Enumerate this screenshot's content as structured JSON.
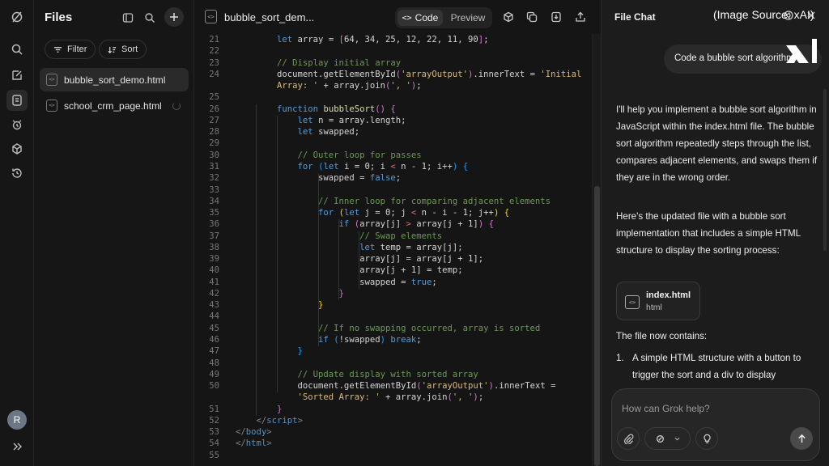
{
  "rail": {
    "avatar_initial": "R"
  },
  "files_panel": {
    "title": "Files",
    "filter_label": "Filter",
    "sort_label": "Sort",
    "files": [
      {
        "name": "bubble_sort_demo.html",
        "active": true
      },
      {
        "name": "school_crm_page.html",
        "active": false
      }
    ]
  },
  "editor": {
    "tab_title": "bubble_sort_dem...",
    "file_icon_glyph": "<>",
    "code_toggle_label": "Code",
    "preview_toggle_label": "Preview",
    "first_line_number": 21,
    "lines": [
      [
        {
          "t": "        let ",
          "c": "kw"
        },
        {
          "t": "array = "
        },
        {
          "t": "[",
          "c": "br2"
        },
        {
          "t": "64, 34, 25, 12, 22, 11, 90"
        },
        {
          "t": "]",
          "c": "br2"
        },
        {
          "t": ";"
        }
      ],
      [],
      [
        {
          "t": "        // Display initial array",
          "c": "com"
        }
      ],
      [
        {
          "t": "        document.getElementById"
        },
        {
          "t": "(",
          "c": "br2"
        },
        {
          "t": "'arrayOutput'",
          "c": "str"
        },
        {
          "t": ")",
          "c": "br2"
        },
        {
          "t": ".innerText = "
        },
        {
          "t": "'Initial",
          "c": "str"
        }
      ],
      [
        {
          "t": "        Array: '",
          "c": "str"
        },
        {
          "t": " + array.join"
        },
        {
          "t": "(",
          "c": "br2"
        },
        {
          "t": "', '",
          "c": "str"
        },
        {
          "t": ")",
          "c": "br2"
        },
        {
          "t": ";"
        }
      ],
      [],
      [
        {
          "t": "        function ",
          "c": "kw"
        },
        {
          "t": "bubbleSort",
          "c": "fn"
        },
        {
          "t": "()",
          "c": "br2"
        },
        {
          "t": " "
        },
        {
          "t": "{",
          "c": "br2"
        }
      ],
      [
        {
          "t": "            let ",
          "c": "kw"
        },
        {
          "t": "n = array.length;"
        }
      ],
      [
        {
          "t": "            let ",
          "c": "kw"
        },
        {
          "t": "swapped;"
        }
      ],
      [],
      [
        {
          "t": "            // Outer loop for passes",
          "c": "com"
        }
      ],
      [
        {
          "t": "            for ",
          "c": "kw"
        },
        {
          "t": "(",
          "c": "br3"
        },
        {
          "t": "let ",
          "c": "kw"
        },
        {
          "t": "i = 0; i "
        },
        {
          "t": "<",
          "c": "op"
        },
        {
          "t": " n - 1; i++"
        },
        {
          "t": ")",
          "c": "br3"
        },
        {
          "t": " "
        },
        {
          "t": "{",
          "c": "br3"
        }
      ],
      [
        {
          "t": "                swapped = "
        },
        {
          "t": "false",
          "c": "kw"
        },
        {
          "t": ";"
        }
      ],
      [],
      [
        {
          "t": "                // Inner loop for comparing adjacent elements",
          "c": "com"
        }
      ],
      [
        {
          "t": "                for ",
          "c": "kw"
        },
        {
          "t": "(",
          "c": "br1"
        },
        {
          "t": "let ",
          "c": "kw"
        },
        {
          "t": "j = 0; j "
        },
        {
          "t": "<",
          "c": "op"
        },
        {
          "t": " n - i - 1; j++"
        },
        {
          "t": ")",
          "c": "br1"
        },
        {
          "t": " "
        },
        {
          "t": "{",
          "c": "br1"
        }
      ],
      [
        {
          "t": "                    if ",
          "c": "kw"
        },
        {
          "t": "(",
          "c": "br2"
        },
        {
          "t": "array[j] "
        },
        {
          "t": ">",
          "c": "op"
        },
        {
          "t": " array[j + 1]"
        },
        {
          "t": ")",
          "c": "br2"
        },
        {
          "t": " "
        },
        {
          "t": "{",
          "c": "br2"
        }
      ],
      [
        {
          "t": "                        // Swap elements",
          "c": "com"
        }
      ],
      [
        {
          "t": "                        let ",
          "c": "kw"
        },
        {
          "t": "temp = array[j];"
        }
      ],
      [
        {
          "t": "                        array[j] = array[j + 1];"
        }
      ],
      [
        {
          "t": "                        array[j + 1] = temp;"
        }
      ],
      [
        {
          "t": "                        swapped = "
        },
        {
          "t": "true",
          "c": "kw"
        },
        {
          "t": ";"
        }
      ],
      [
        {
          "t": "                    }",
          "c": "br2"
        }
      ],
      [
        {
          "t": "                }",
          "c": "br1"
        }
      ],
      [],
      [
        {
          "t": "                // If no swapping occurred, array is sorted",
          "c": "com"
        }
      ],
      [
        {
          "t": "                if ",
          "c": "kw"
        },
        {
          "t": "(",
          "c": "br3"
        },
        {
          "t": "!swapped"
        },
        {
          "t": ")",
          "c": "br3"
        },
        {
          "t": " "
        },
        {
          "t": "break",
          "c": "kw"
        },
        {
          "t": ";"
        }
      ],
      [
        {
          "t": "            }",
          "c": "br3"
        }
      ],
      [],
      [
        {
          "t": "            // Update display with sorted array",
          "c": "com"
        }
      ],
      [
        {
          "t": "            document.getElementById"
        },
        {
          "t": "(",
          "c": "br2"
        },
        {
          "t": "'arrayOutput'",
          "c": "str"
        },
        {
          "t": ")",
          "c": "br2"
        },
        {
          "t": ".innerText ="
        }
      ],
      [
        {
          "t": "            'Sorted Array: '",
          "c": "str"
        },
        {
          "t": " + array.join"
        },
        {
          "t": "(",
          "c": "br2"
        },
        {
          "t": "', '",
          "c": "str"
        },
        {
          "t": ")",
          "c": "br2"
        },
        {
          "t": ";"
        }
      ],
      [
        {
          "t": "        }",
          "c": "br2"
        }
      ],
      [
        {
          "t": "    </",
          "c": "tag"
        },
        {
          "t": "script",
          "c": "tagn"
        },
        {
          "t": ">",
          "c": "tag"
        }
      ],
      [
        {
          "t": "</",
          "c": "tag"
        },
        {
          "t": "body",
          "c": "tagn"
        },
        {
          "t": ">",
          "c": "tag"
        }
      ],
      [
        {
          "t": "</",
          "c": "tag"
        },
        {
          "t": "html",
          "c": "tagn"
        },
        {
          "t": ">",
          "c": "tag"
        }
      ],
      []
    ]
  },
  "chat": {
    "title": "File Chat",
    "image_source_label": "(Image Source: xAI)",
    "user_message": "Code a bubble sort algorithm",
    "assistant_p1": "I'll help you implement a bubble sort algorithm in JavaScript within the index.html file. The bubble sort algorithm repeatedly steps through the list, compares adjacent elements, and swaps them if they are in the wrong order.",
    "assistant_p2": "Here's the updated file with a bubble sort implementation that includes a simple HTML structure to display the sorting process:",
    "attachment": {
      "name": "index.html",
      "type": "html"
    },
    "assistant_p3": "The file now contains:",
    "list_items": [
      {
        "num": "1.",
        "text": "A simple HTML structure with a button to trigger the sort and a div to display"
      }
    ],
    "composer_placeholder": "How can Grok help?"
  }
}
